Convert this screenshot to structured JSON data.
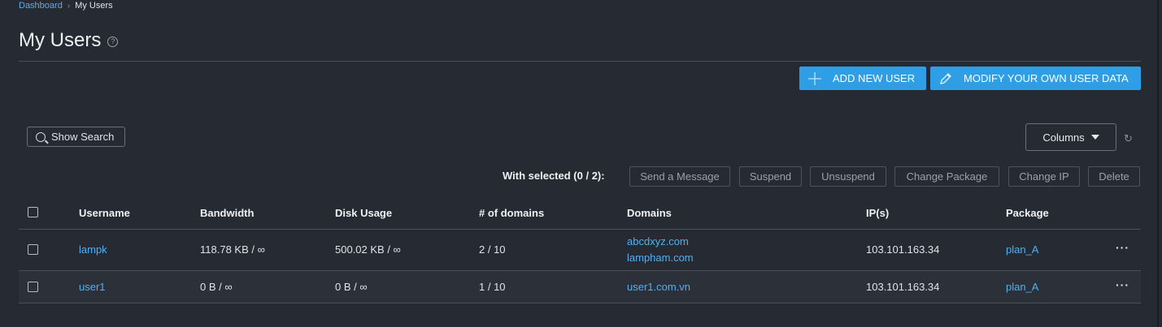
{
  "breadcrumb": {
    "root": "Dashboard",
    "separator": "›",
    "current": "My Users"
  },
  "page": {
    "title": "My Users",
    "help": "?"
  },
  "buttons": {
    "add_user": "ADD NEW USER",
    "modify_self": "MODIFY YOUR OWN USER DATA"
  },
  "toolbar": {
    "show_search": "Show Search",
    "columns": "Columns",
    "refresh": "↻"
  },
  "bulk": {
    "label": "With selected (0 / 2):",
    "actions": [
      "Send a Message",
      "Suspend",
      "Unsuspend",
      "Change Package",
      "Change IP",
      "Delete"
    ]
  },
  "table": {
    "headers": [
      "Username",
      "Bandwidth",
      "Disk Usage",
      "# of domains",
      "Domains",
      "IP(s)",
      "Package"
    ],
    "rows": [
      {
        "username": "lampk",
        "bandwidth": "118.78 KB / ∞",
        "disk": "500.02 KB / ∞",
        "domains_count": "2 / 10",
        "domains": [
          "abcdxyz.com",
          "lampham.com"
        ],
        "ip": "103.101.163.34",
        "package": "plan_A",
        "more": "···"
      },
      {
        "username": "user1",
        "bandwidth": "0 B / ∞",
        "disk": "0 B / ∞",
        "domains_count": "1 / 10",
        "domains": [
          "user1.com.vn"
        ],
        "ip": "103.101.163.34",
        "package": "plan_A",
        "more": "···"
      }
    ]
  },
  "colors": {
    "accent": "#2e9fe6",
    "link": "#4fb1f3",
    "background": "#262a33"
  }
}
